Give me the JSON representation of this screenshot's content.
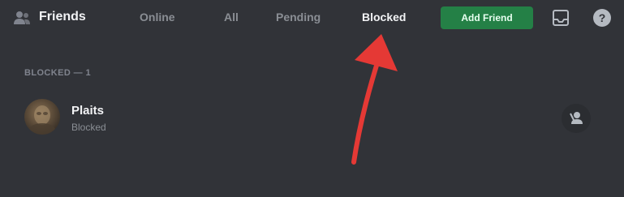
{
  "header": {
    "title": "Friends",
    "icon": "friends-icon",
    "tabs": [
      {
        "label": "Online",
        "active": false
      },
      {
        "label": "All",
        "active": false
      },
      {
        "label": "Pending",
        "active": false
      },
      {
        "label": "Blocked",
        "active": true
      }
    ],
    "add_friend_label": "Add Friend",
    "add_friend_color": "#248046",
    "inbox_icon": "inbox-icon",
    "help_icon": "help-icon"
  },
  "blocked": {
    "section_label": "Blocked — 1",
    "friends": [
      {
        "name": "Plaits",
        "status": "Blocked",
        "action_icon": "unblock-icon"
      }
    ]
  },
  "annotation": {
    "arrow_color": "#e53935",
    "arrow_icon": "red-arrow-icon"
  }
}
